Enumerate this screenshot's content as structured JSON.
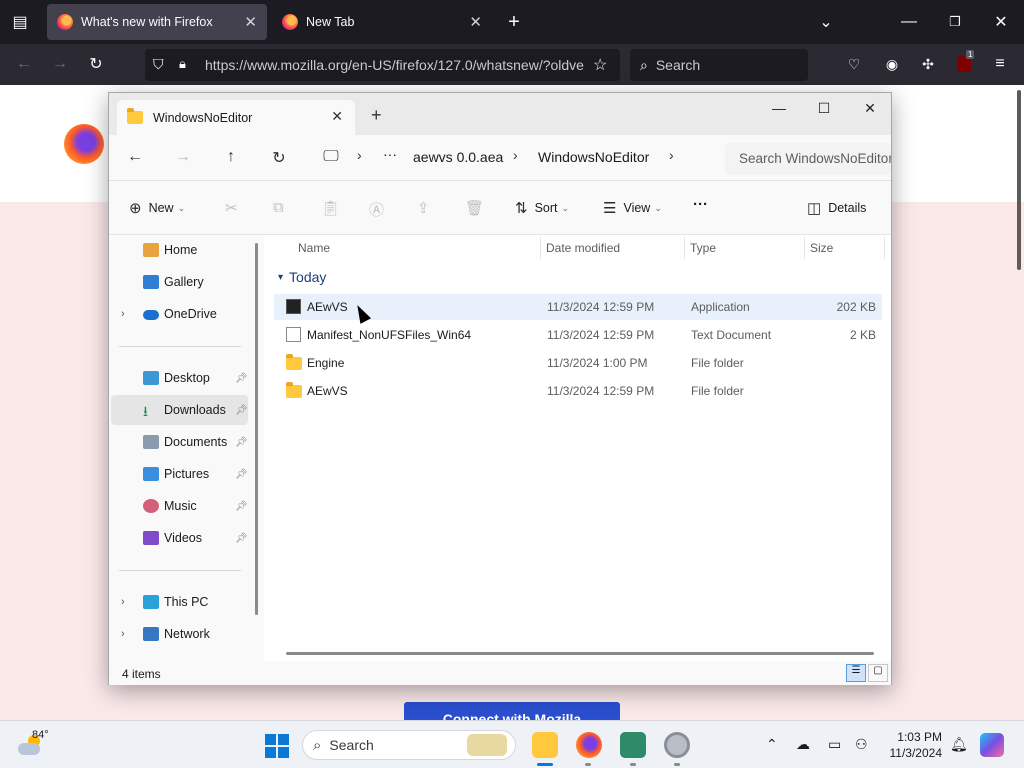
{
  "browser": {
    "tabs": [
      {
        "title": "What's new with Firefox",
        "active": true
      },
      {
        "title": "New Tab",
        "active": false
      }
    ],
    "url": "https://www.mozilla.org/en-US/firefox/127.0/whatsnew/?oldve",
    "search_placeholder": "Search",
    "extension_badge": "1"
  },
  "page": {
    "connect_button": "Connect with Mozilla"
  },
  "explorer": {
    "tab_title": "WindowsNoEditor",
    "breadcrumbs": [
      "aewvs 0.0.aea",
      "WindowsNoEditor"
    ],
    "search_placeholder": "Search WindowsNoEditor",
    "commands": {
      "new": "New",
      "sort": "Sort",
      "view": "View",
      "details": "Details"
    },
    "nav": {
      "home": "Home",
      "gallery": "Gallery",
      "onedrive": "OneDrive",
      "desktop": "Desktop",
      "downloads": "Downloads",
      "documents": "Documents",
      "pictures": "Pictures",
      "music": "Music",
      "videos": "Videos",
      "thispc": "This PC",
      "network": "Network"
    },
    "columns": {
      "name": "Name",
      "date": "Date modified",
      "type": "Type",
      "size": "Size"
    },
    "group": "Today",
    "files": [
      {
        "name": "AEwVS",
        "date": "11/3/2024 12:59 PM",
        "type": "Application",
        "size": "202 KB",
        "icon": "app-icon"
      },
      {
        "name": "Manifest_NonUFSFiles_Win64",
        "date": "11/3/2024 12:59 PM",
        "type": "Text Document",
        "size": "2 KB",
        "icon": "text-file-icon"
      },
      {
        "name": "Engine",
        "date": "11/3/2024 1:00 PM",
        "type": "File folder",
        "size": "",
        "icon": "folder-icon"
      },
      {
        "name": "AEwVS",
        "date": "11/3/2024 12:59 PM",
        "type": "File folder",
        "size": "",
        "icon": "folder-icon"
      }
    ],
    "item_count": "4 items"
  },
  "taskbar": {
    "temperature": "84°",
    "search_placeholder": "Search",
    "time": "1:03 PM",
    "date": "11/3/2024"
  }
}
